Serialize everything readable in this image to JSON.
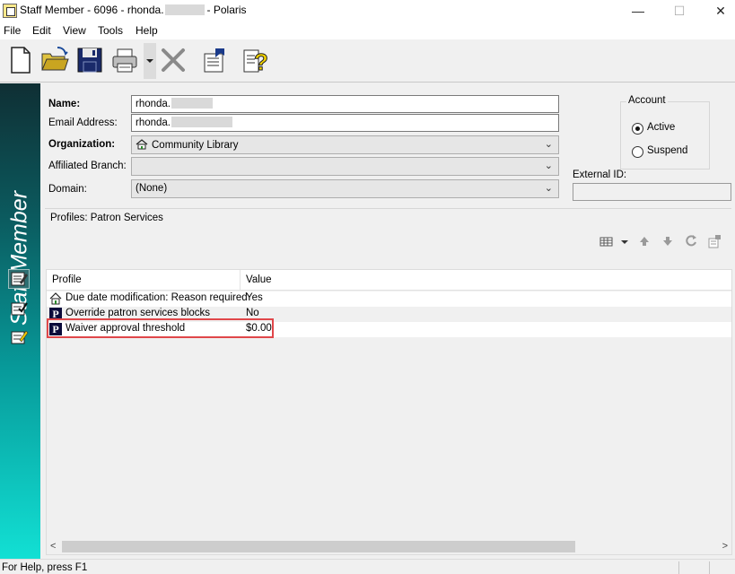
{
  "window": {
    "title_prefix": "Staff Member - 6096 - rhonda.",
    "title_suffix": "- Polaris",
    "minimize_glyph": "—",
    "maximize_glyph": "☐",
    "close_glyph": "✕"
  },
  "menu": [
    "File",
    "Edit",
    "View",
    "Tools",
    "Help"
  ],
  "toolbar": {
    "icons": [
      "new-document-icon",
      "open-folder-icon",
      "save-disk-icon",
      "printer-icon",
      "delete-x-icon",
      "properties-icon",
      "help-question-icon"
    ]
  },
  "sidebar": {
    "title": "Staff Member",
    "buttons": [
      "staff-edit-icon",
      "staff-check-icon",
      "staff-pencil-icon"
    ],
    "colors": {
      "top": "#0f2f34",
      "bottom": "#12e0d4"
    }
  },
  "form": {
    "name_label": "Name:",
    "name_value": "rhonda.",
    "email_label": "Email Address:",
    "email_value": "rhonda.",
    "org_label": "Organization:",
    "org_value": "Community Library",
    "branch_label": "Affiliated Branch:",
    "branch_value": "",
    "domain_label": "Domain:",
    "domain_value": "(None)",
    "external_id_label": "External ID:",
    "external_id_value": ""
  },
  "account": {
    "legend": "Account",
    "options": [
      {
        "label": "Active",
        "selected": true
      },
      {
        "label": "Suspend",
        "selected": false
      }
    ]
  },
  "profiles": {
    "section_label": "Profiles: Patron Services",
    "tool_icons": [
      "grid-view-icon",
      "dropdown-arrow-icon",
      "move-up-icon",
      "move-down-icon",
      "refresh-icon",
      "properties-icon"
    ],
    "columns": [
      "Profile",
      "Value"
    ],
    "rows": [
      {
        "icon": "library-house-icon",
        "profile": "Due date modification: Reason required",
        "value": "Yes"
      },
      {
        "icon": "polaris-p-icon",
        "profile": "Override patron services blocks",
        "value": "No"
      },
      {
        "icon": "polaris-p-icon",
        "profile": "Waiver approval threshold",
        "value": "$0.00",
        "highlighted": true
      }
    ],
    "scroll_left": "<",
    "scroll_right": ">"
  },
  "status": {
    "text": "For Help, press F1"
  },
  "colors": {
    "highlight": "#e0474a",
    "sidebar_text": "#ffffff"
  }
}
